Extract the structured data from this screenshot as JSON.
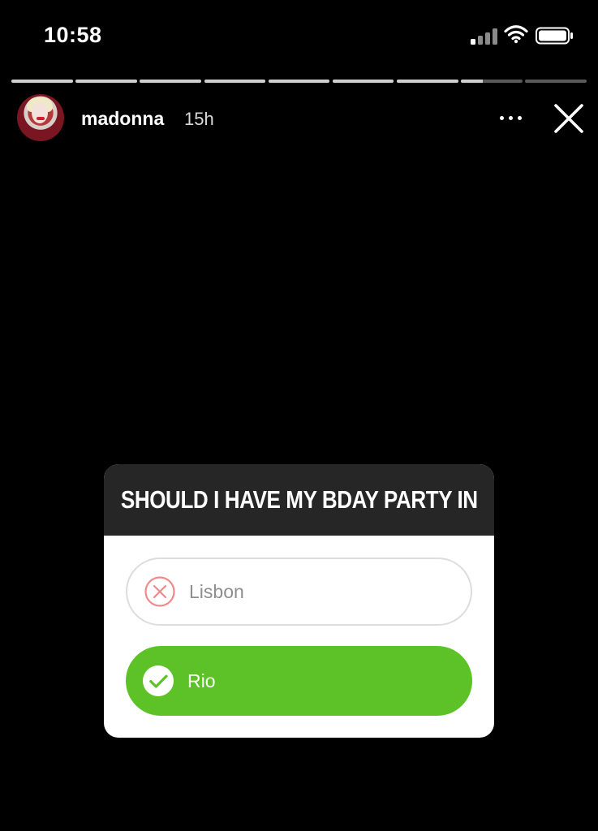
{
  "status_bar": {
    "time": "10:58",
    "icons": [
      "signal-icon",
      "wifi-icon",
      "battery-icon"
    ]
  },
  "story": {
    "progress_segments": [
      {
        "progress": 1
      },
      {
        "progress": 1
      },
      {
        "progress": 1
      },
      {
        "progress": 1
      },
      {
        "progress": 1
      },
      {
        "progress": 1
      },
      {
        "progress": 1
      },
      {
        "progress": 0.35
      },
      {
        "progress": 0
      }
    ],
    "header": {
      "username": "madonna",
      "time_ago": "15h",
      "more_icon": "more-icon",
      "close_icon": "close-icon"
    },
    "poll": {
      "question": "SHOULD I HAVE MY BDAY PARTY IN",
      "options": [
        {
          "label": "Lisbon",
          "state": "not-selected",
          "icon": "x-circle-icon",
          "color": "#F08A8A"
        },
        {
          "label": "Rio",
          "state": "selected",
          "icon": "check-circle-icon",
          "color": "#5CC228"
        }
      ]
    }
  }
}
